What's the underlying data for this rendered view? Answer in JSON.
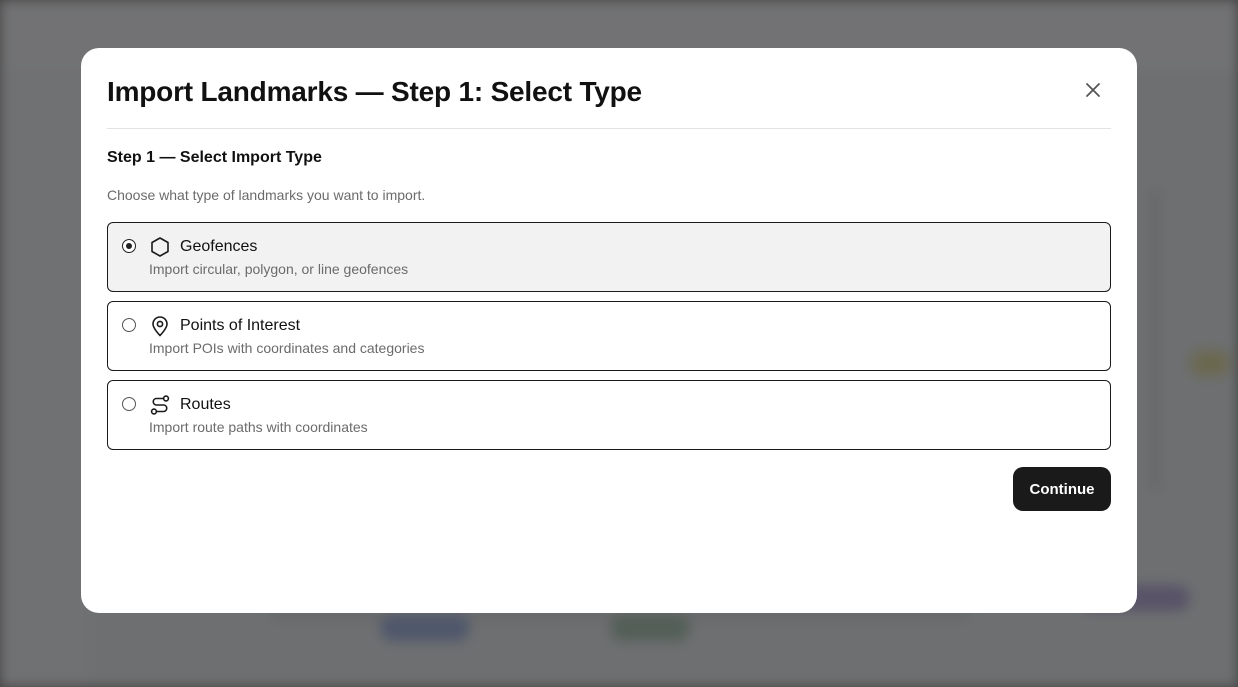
{
  "modal": {
    "title": "Import Landmarks — Step 1: Select Type",
    "close_icon": "close-icon",
    "step_heading": "Step 1 — Select Import Type",
    "step_description": "Choose what type of landmarks you want to import.",
    "options": [
      {
        "label": "Geofences",
        "description": "Import circular, polygon, or line geofences",
        "icon": "hexagon-icon",
        "selected": true
      },
      {
        "label": "Points of Interest",
        "description": "Import POIs with coordinates and categories",
        "icon": "map-pin-icon",
        "selected": false
      },
      {
        "label": "Routes",
        "description": "Import route paths with coordinates",
        "icon": "route-icon",
        "selected": false
      }
    ],
    "continue_label": "Continue"
  },
  "colors": {
    "primary_button": "#1a1a1a",
    "selected_option_bg": "#f2f2f2",
    "overlay": "#6e6e6e"
  }
}
